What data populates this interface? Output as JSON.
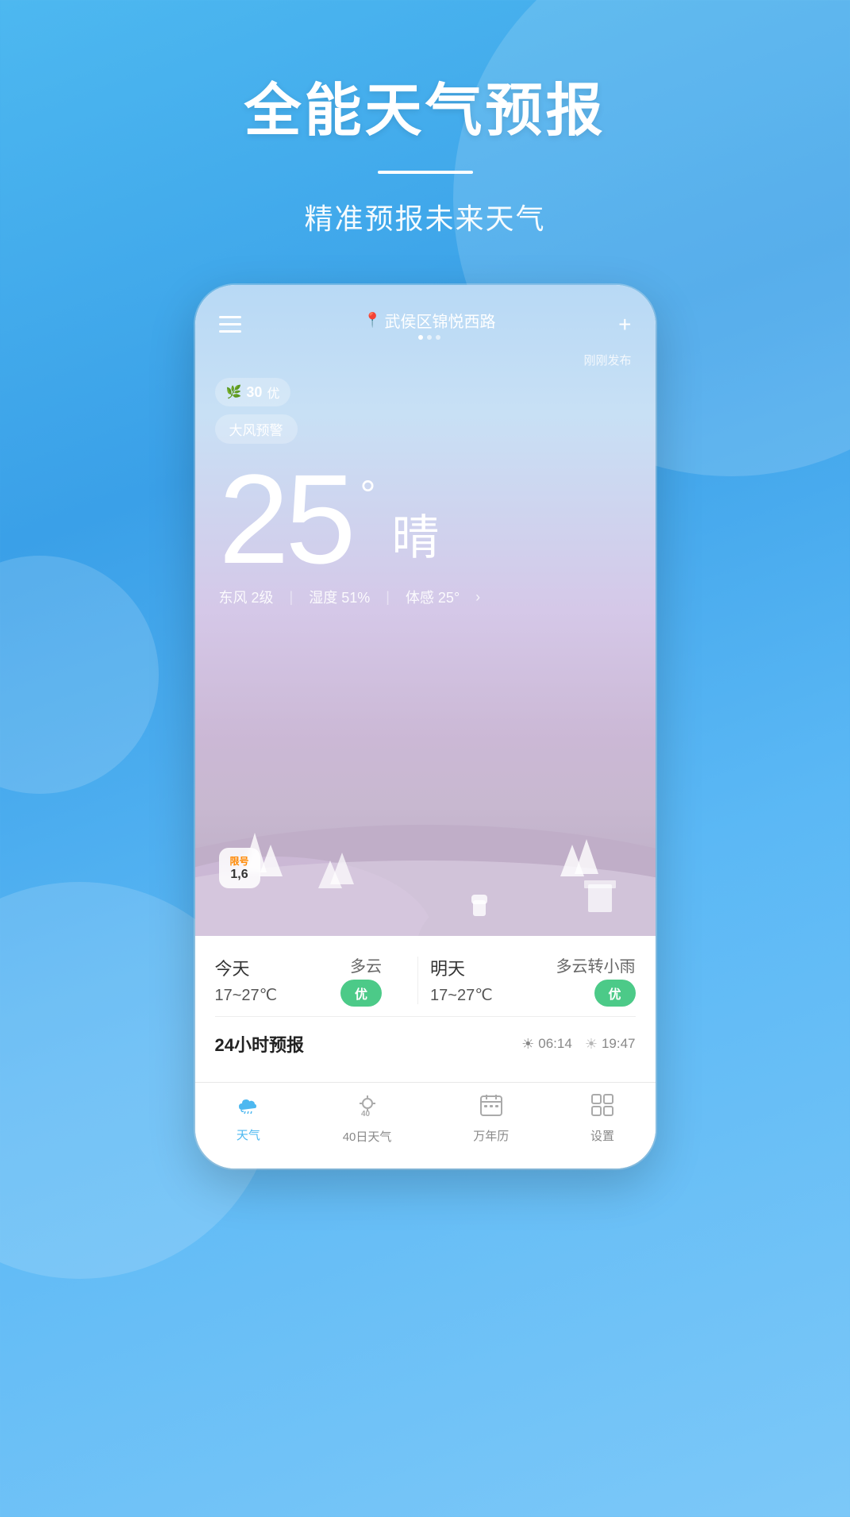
{
  "title": {
    "main": "全能天气预报",
    "divider": true,
    "subtitle": "精准预报未来天气"
  },
  "phone": {
    "location": "武侯区锦悦西路",
    "just_published": "刚刚发布",
    "aqi": {
      "number": "30",
      "label": "优"
    },
    "warning": "大风预警",
    "temperature": "25",
    "degree": "°",
    "condition": "晴",
    "details": {
      "wind": "东风 2级",
      "humidity": "湿度 51%",
      "feel": "体感 25°"
    },
    "license": {
      "title": "限号",
      "numbers": "1,6"
    },
    "forecast": {
      "today": {
        "label": "今天",
        "condition": "多云",
        "temp": "17~27℃",
        "quality": "优"
      },
      "tomorrow": {
        "label": "明天",
        "condition": "多云转小雨",
        "temp": "17~27℃",
        "quality": "优"
      }
    },
    "forecast_24h": {
      "title": "24小时预报",
      "sunrise": "06:14",
      "sunset": "19:47"
    }
  },
  "nav": {
    "items": [
      {
        "label": "天气",
        "active": true,
        "icon": "cloud"
      },
      {
        "label": "40日天气",
        "active": false,
        "icon": "sun40"
      },
      {
        "label": "万年历",
        "active": false,
        "icon": "calendar"
      },
      {
        "label": "设置",
        "active": false,
        "icon": "grid"
      }
    ]
  }
}
